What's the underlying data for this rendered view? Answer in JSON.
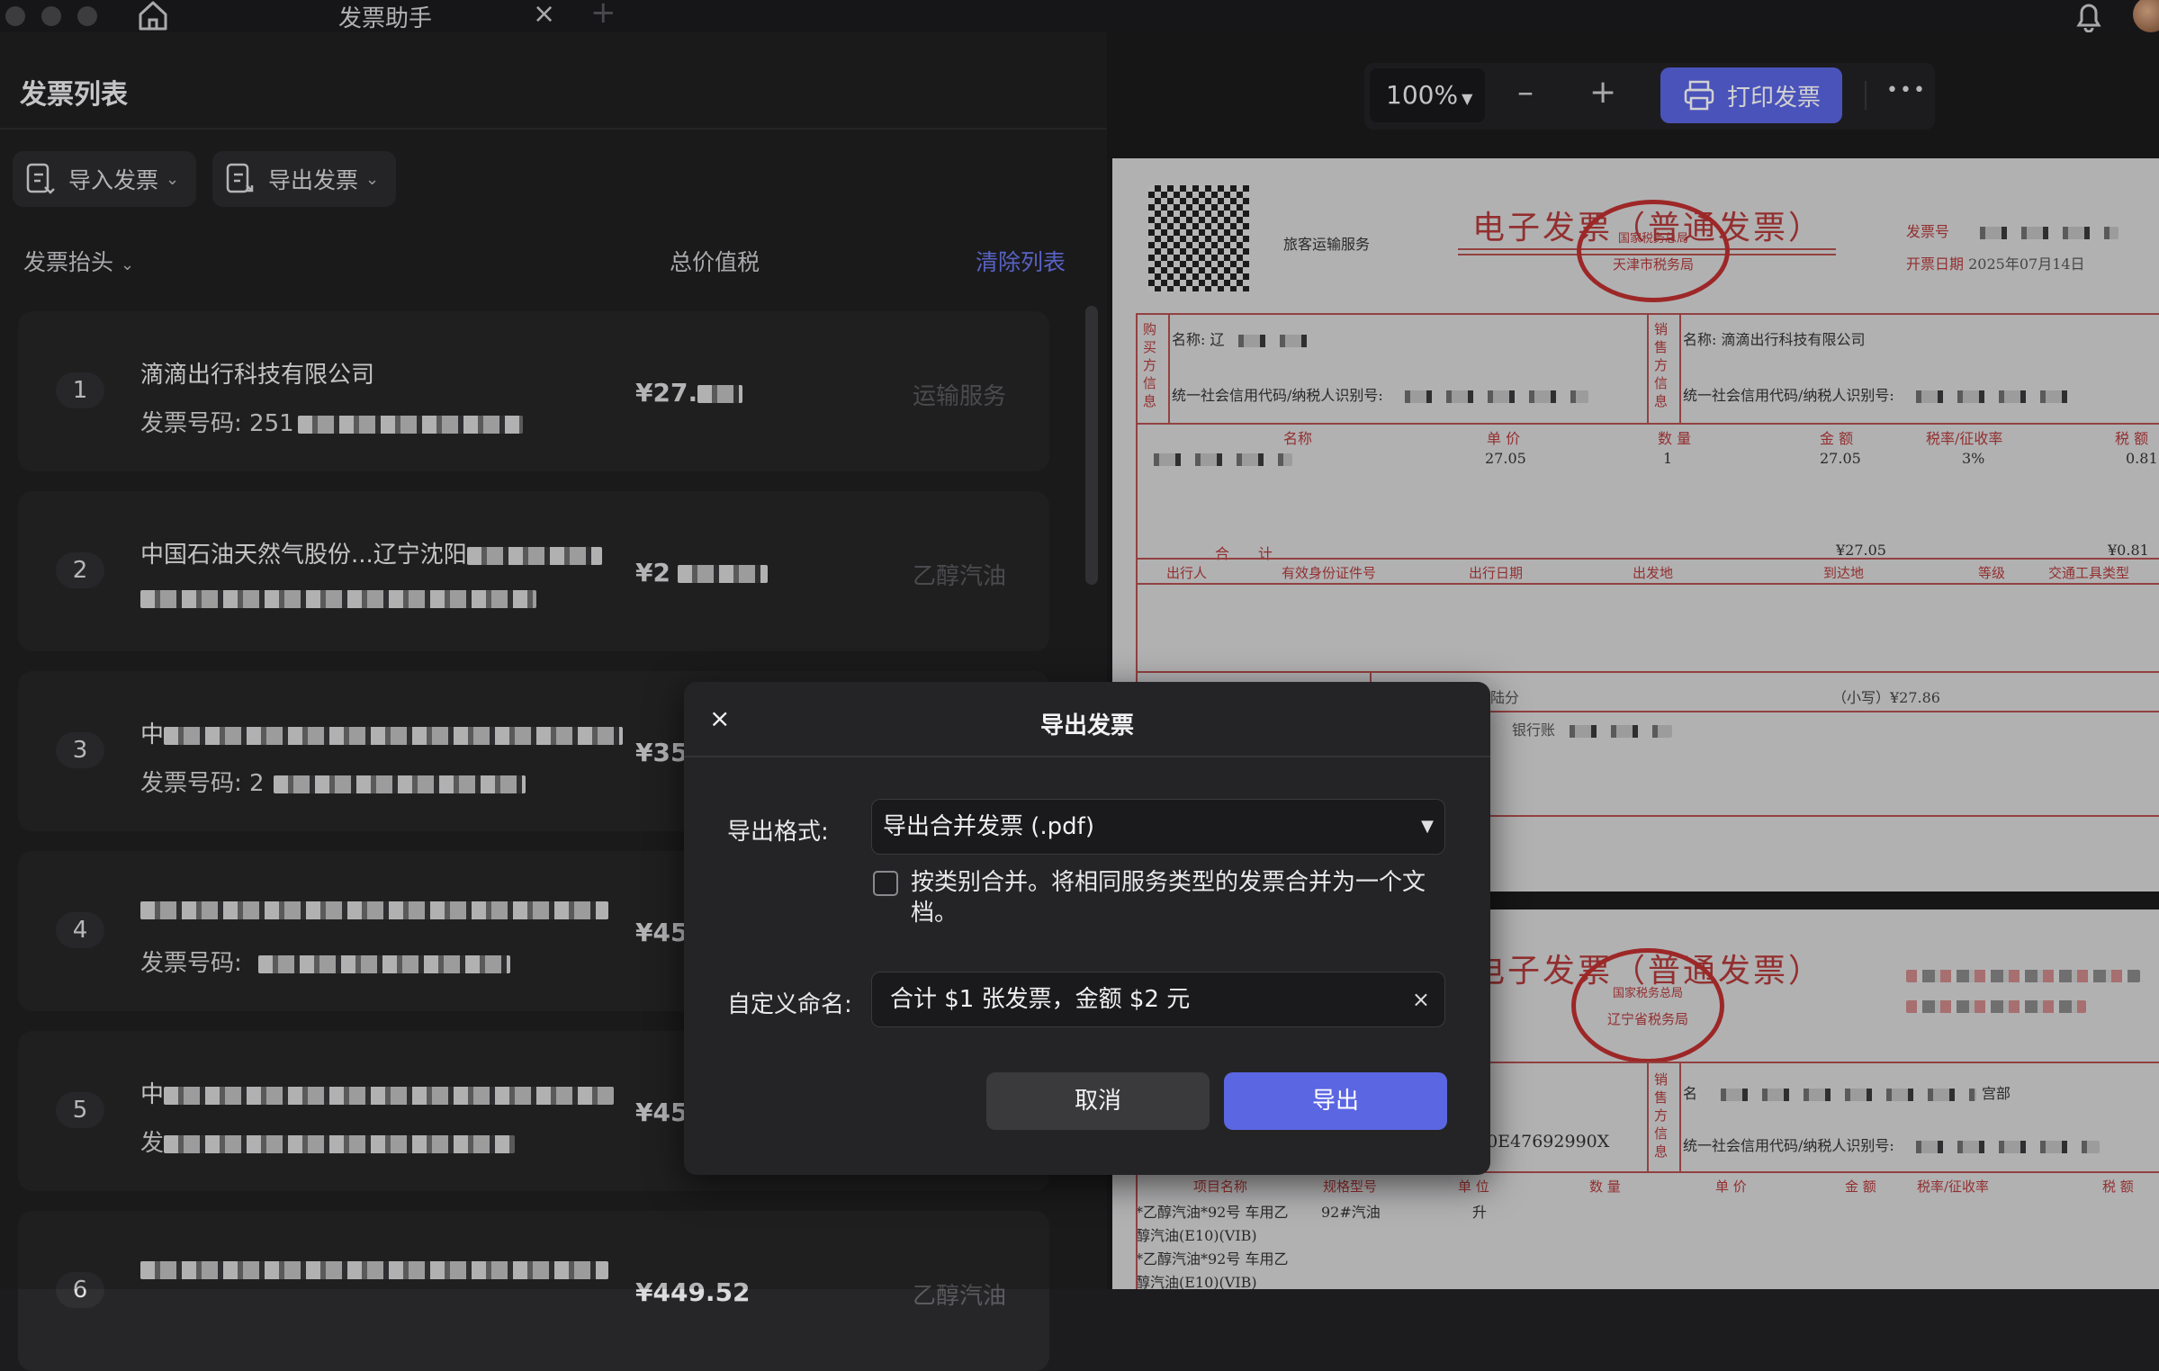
{
  "titlebar": {
    "tab_title": "发票助手",
    "close": "×",
    "new_tab": "+"
  },
  "left": {
    "title": "发票列表",
    "import_label": "导入发票",
    "export_label": "导出发票",
    "col_header": "发票抬头",
    "col_total": "总价值税",
    "clear_list": "清除列表"
  },
  "invoices": [
    {
      "num": "1",
      "title": "滴滴出行科技有限公司",
      "sub": "发票号码: 251",
      "amount": "¥27.",
      "type": "运输服务"
    },
    {
      "num": "2",
      "title": "中国石油天然气股份...辽宁沈阳",
      "sub": "",
      "amount": "¥2",
      "type": "乙醇汽油"
    },
    {
      "num": "3",
      "title": "中",
      "sub": "发票号码: 2",
      "amount": "¥35",
      "type": ""
    },
    {
      "num": "4",
      "title": "",
      "sub": "发票号码: ",
      "amount": "¥45",
      "type": ""
    },
    {
      "num": "5",
      "title": "中",
      "sub": "发",
      "amount": "¥45",
      "type": ""
    },
    {
      "num": "6",
      "title": "",
      "sub": "",
      "amount": "¥449.52",
      "type": "乙醇汽油"
    }
  ],
  "viewer": {
    "zoom": "100%",
    "zoom_out": "–",
    "zoom_in": "+",
    "print_label": "打印发票",
    "more": "•••"
  },
  "invoice1": {
    "title": "电子发票（普通发票）",
    "service": "旅客运输服务",
    "invoice_no_label": "发票号",
    "date_label": "开票日期",
    "date_value": "2025年07月14日",
    "buyer_label": "名称: 辽",
    "buyer_tax": "统一社会信用代码/纳税人识别号:",
    "seller_name": "名称: 滴滴出行科技有限公司",
    "seller_tax": "统一社会信用代码/纳税人识别号:",
    "buyer_side": "购买方信息",
    "seller_side": "销售方信息",
    "stamp_text": "天津市税务局",
    "stamp_top": "国家税务总局",
    "cols": [
      "名称",
      "单 价",
      "数 量",
      "金 额",
      "税率/征收率",
      "税 额"
    ],
    "row": [
      "27.05",
      "1",
      "27.05",
      "3%",
      "0.81"
    ],
    "total_label": "合　　计",
    "total_amount": "¥27.05",
    "total_tax": "¥0.81",
    "travel_cols": [
      "出行人",
      "有效身份证件号",
      "出行日期",
      "出发地",
      "到达地",
      "等级",
      "交通工具类型"
    ],
    "small_label": "（小写）¥27.86",
    "capital": "贰拾柒圆捌角陆分",
    "bank": "银行账"
  },
  "invoice2": {
    "title": "电子发票（普通发票）",
    "stamp_text": "辽宁省税务局",
    "stamp_top": "国家税务总局",
    "seller_side": "销售方信息",
    "seller_name": "名",
    "seller_suffix": "宫部",
    "seller_tax": "统一社会信用代码/纳税人识别号:",
    "buyer_tax_tail": "00E47692990X",
    "cols": [
      "项目名称",
      "规格型号",
      "单 位",
      "数 量",
      "单 价",
      "金 额",
      "税率/征收率",
      "税 额"
    ],
    "item1": "*乙醇汽油*92号 车用乙",
    "item1b": "醇汽油(E10)(VIB)",
    "item2": "*乙醇汽油*92号 车用乙",
    "item2b": "醇汽油(E10)(VIB)",
    "spec": "92#汽油",
    "unit": "升"
  },
  "dialog": {
    "title": "导出发票",
    "close": "×",
    "format_label": "导出格式:",
    "format_value": "导出合并发票 (.pdf)",
    "merge_text": "按类别合并。将相同服务类型的发票合并为一个文档。",
    "name_label": "自定义命名:",
    "name_value": "合计 $1 张发票，金额 $2 元",
    "clear": "×",
    "cancel": "取消",
    "export": "导出"
  },
  "colors": {
    "accent": "#5b66e3",
    "link": "#6c78f0",
    "invoice_red": "#b43a3a"
  }
}
